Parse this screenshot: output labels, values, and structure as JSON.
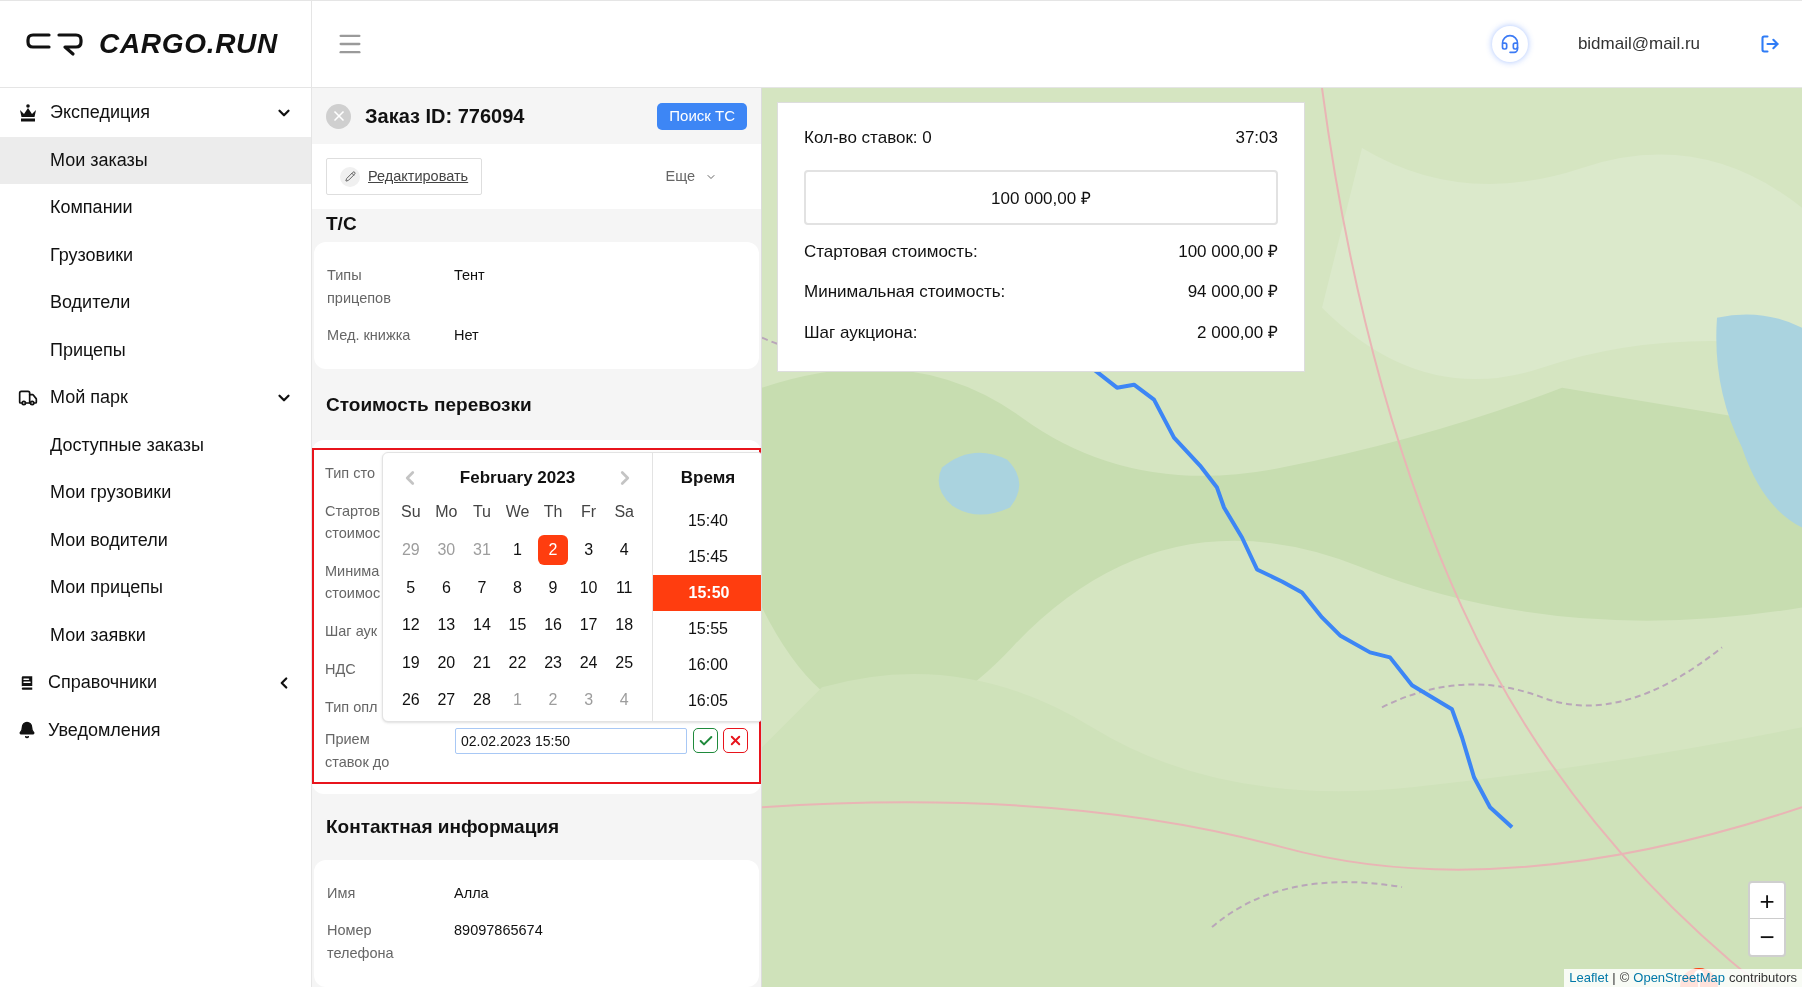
{
  "brand": {
    "name": "CARGO.RUN"
  },
  "header": {
    "user_email": "bidmail@mail.ru"
  },
  "sidebar": {
    "groups": [
      {
        "label": "Экспедиция",
        "kind": "group",
        "expanded": true,
        "children": [
          {
            "label": "Мои заказы",
            "selected": true
          },
          {
            "label": "Компании",
            "selected": false
          },
          {
            "label": "Грузовики",
            "selected": false
          },
          {
            "label": "Водители",
            "selected": false
          },
          {
            "label": "Прицепы",
            "selected": false
          }
        ]
      },
      {
        "label": "Мой парк",
        "kind": "group",
        "expanded": true,
        "children": [
          {
            "label": "Доступные заказы",
            "selected": false
          },
          {
            "label": "Мои грузовики",
            "selected": false
          },
          {
            "label": "Мои водители",
            "selected": false
          },
          {
            "label": "Мои прицепы",
            "selected": false
          },
          {
            "label": "Мои заявки",
            "selected": false
          }
        ]
      },
      {
        "label": "Справочники",
        "kind": "group",
        "expanded": false
      },
      {
        "label": "Уведомления",
        "kind": "link"
      }
    ]
  },
  "order": {
    "title": "Заказ ID: 776094",
    "search_button": "Поиск ТС",
    "edit_button": "Редактировать",
    "more_menu": "Еще"
  },
  "vehicle": {
    "heading": "Т/С",
    "rows": [
      {
        "label": "Типы прицепов",
        "value": "Тент"
      },
      {
        "label": "Мед. книжка",
        "value": "Нет"
      }
    ]
  },
  "cost": {
    "heading": "Стоимость перевозки",
    "highlighted": true,
    "rows": [
      {
        "label": "Тип сто"
      },
      {
        "label": "Стартов стоимос"
      },
      {
        "label": "Минима стоимос"
      },
      {
        "label": "Шаг аук"
      },
      {
        "label": "НДС"
      },
      {
        "label": "Тип опл"
      }
    ],
    "deadline": {
      "label": "Прием ставок до",
      "value": "02.02.2023 15:50"
    }
  },
  "datepicker": {
    "month": "February 2023",
    "weekdays": [
      "Su",
      "Mo",
      "Tu",
      "We",
      "Th",
      "Fr",
      "Sa"
    ],
    "days": [
      {
        "label": "29",
        "outside": true,
        "selected": false
      },
      {
        "label": "30",
        "outside": true,
        "selected": false
      },
      {
        "label": "31",
        "outside": true,
        "selected": false
      },
      {
        "label": "1",
        "outside": false,
        "selected": false
      },
      {
        "label": "2",
        "outside": false,
        "selected": true
      },
      {
        "label": "3",
        "outside": false,
        "selected": false
      },
      {
        "label": "4",
        "outside": false,
        "selected": false
      },
      {
        "label": "5",
        "outside": false,
        "selected": false
      },
      {
        "label": "6",
        "outside": false,
        "selected": false
      },
      {
        "label": "7",
        "outside": false,
        "selected": false
      },
      {
        "label": "8",
        "outside": false,
        "selected": false
      },
      {
        "label": "9",
        "outside": false,
        "selected": false
      },
      {
        "label": "10",
        "outside": false,
        "selected": false
      },
      {
        "label": "11",
        "outside": false,
        "selected": false
      },
      {
        "label": "12",
        "outside": false,
        "selected": false
      },
      {
        "label": "13",
        "outside": false,
        "selected": false
      },
      {
        "label": "14",
        "outside": false,
        "selected": false
      },
      {
        "label": "15",
        "outside": false,
        "selected": false
      },
      {
        "label": "16",
        "outside": false,
        "selected": false
      },
      {
        "label": "17",
        "outside": false,
        "selected": false
      },
      {
        "label": "18",
        "outside": false,
        "selected": false
      },
      {
        "label": "19",
        "outside": false,
        "selected": false
      },
      {
        "label": "20",
        "outside": false,
        "selected": false
      },
      {
        "label": "21",
        "outside": false,
        "selected": false
      },
      {
        "label": "22",
        "outside": false,
        "selected": false
      },
      {
        "label": "23",
        "outside": false,
        "selected": false
      },
      {
        "label": "24",
        "outside": false,
        "selected": false
      },
      {
        "label": "25",
        "outside": false,
        "selected": false
      },
      {
        "label": "26",
        "outside": false,
        "selected": false
      },
      {
        "label": "27",
        "outside": false,
        "selected": false
      },
      {
        "label": "28",
        "outside": false,
        "selected": false
      },
      {
        "label": "1",
        "outside": true,
        "selected": false
      },
      {
        "label": "2",
        "outside": true,
        "selected": false
      },
      {
        "label": "3",
        "outside": true,
        "selected": false
      },
      {
        "label": "4",
        "outside": true,
        "selected": false
      }
    ],
    "time_header": "Время",
    "times": [
      {
        "label": "15:40",
        "selected": false
      },
      {
        "label": "15:45",
        "selected": false
      },
      {
        "label": "15:50",
        "selected": true
      },
      {
        "label": "15:55",
        "selected": false
      },
      {
        "label": "16:00",
        "selected": false
      },
      {
        "label": "16:05",
        "selected": false
      }
    ]
  },
  "contact": {
    "heading": "Контактная информация",
    "rows": [
      {
        "label": "Имя",
        "value": "Алла"
      },
      {
        "label": "Номер телефона",
        "value": "89097865674"
      }
    ]
  },
  "auction": {
    "bids_label": "Кол-во ставок: 0",
    "timer": "37:03",
    "bid_value": "100 000,00 ₽",
    "rows": [
      {
        "label": "Стартовая стоимость:",
        "value": "100 000,00 ₽"
      },
      {
        "label": "Минимальная стоимость:",
        "value": "94 000,00 ₽"
      },
      {
        "label": "Шаг аукциона:",
        "value": "2 000,00 ₽"
      }
    ]
  },
  "map": {
    "kind": "picture",
    "zoom_in": "+",
    "zoom_out": "−",
    "attribution": {
      "leaflet_link": "Leaflet",
      "separator": "|",
      "copyright": "©",
      "osm_link": "OpenStreetMap",
      "suffix": "contributors"
    }
  }
}
